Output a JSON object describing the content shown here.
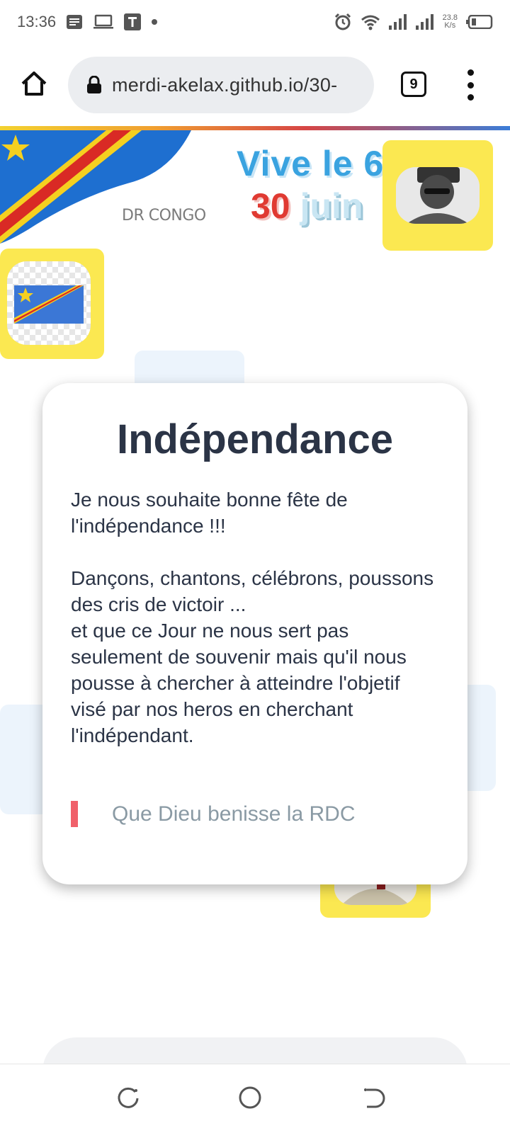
{
  "status_bar": {
    "time": "13:36",
    "net_speed_value": "23.8",
    "net_speed_unit": "K/s",
    "icons": [
      "notes-icon",
      "laptop-icon",
      "t-app-icon",
      "dot-icon",
      "alarm-icon",
      "wifi-icon",
      "signal-icon",
      "signal-icon",
      "battery-icon"
    ]
  },
  "browser": {
    "url": "merdi-akelax.github.io/30-",
    "tab_count": "9"
  },
  "hero": {
    "country_label": "DR CONGO",
    "headline": "Vive le 6",
    "date_number": "30",
    "date_month": "juin"
  },
  "modal": {
    "title": "Indépendance",
    "paragraph1": "Je nous souhaite bonne fête de l'indépendance !!!",
    "paragraph2_line1": "Dançons, chantons, célébrons, poussons des cris de victoir ...",
    "paragraph2_line2": "et que ce Jour ne nous sert pas seulement de souvenir mais qu'il nous pousse à chercher à atteindre l'objetif visé par nos heros en cherchant l'indépendant.",
    "quote": "Que Dieu benisse la RDC"
  },
  "colors": {
    "accent_yellow": "#fbe851",
    "headline_blue": "#3aa3e0",
    "date_red": "#e03a32",
    "quote_bar": "#f0606a"
  }
}
